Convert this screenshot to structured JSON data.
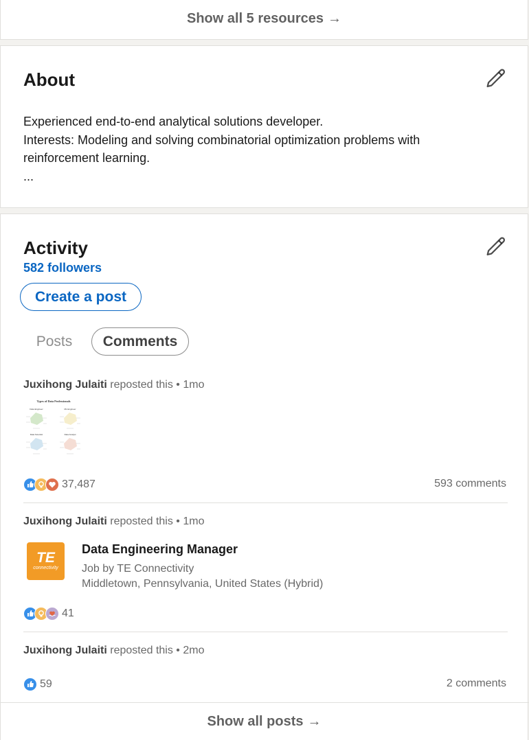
{
  "resources": {
    "show_all_label": "Show all 5 resources",
    "arrow": "→"
  },
  "about": {
    "title": "About",
    "lines": [
      "Experienced end-to-end analytical solutions developer.",
      "Interests: Modeling and solving combinatorial optimization problems with",
      "reinforcement learning.",
      "..."
    ]
  },
  "activity": {
    "title": "Activity",
    "followers": "582 followers",
    "create_post_label": "Create a post",
    "tabs": [
      {
        "label": "Posts",
        "selected": false
      },
      {
        "label": "Comments",
        "selected": true
      }
    ],
    "items": [
      {
        "reposter": "Juxihong Julaiti",
        "action": " reposted this • 1mo",
        "reaction_icons": [
          "like-icon",
          "insightful-icon",
          "love-icon"
        ],
        "reaction_count": "37,487",
        "comments": "593 comments",
        "image_title": "Types of Data Professionals",
        "image_labels": [
          "Data Engineer",
          "ML Engineer",
          "Data Scientist",
          "Data Analyst"
        ]
      },
      {
        "reposter": "Juxihong Julaiti",
        "action": " reposted this • 1mo",
        "job": {
          "logo_text": "TE",
          "logo_subtext": "connectivity",
          "title": "Data Engineering Manager",
          "company_line": "Job by TE Connectivity",
          "location": "Middletown, Pennsylvania, United States (Hybrid)"
        },
        "reaction_icons": [
          "like-icon",
          "insightful-icon",
          "support-icon"
        ],
        "reaction_count": "41"
      },
      {
        "reposter": "Juxihong Julaiti",
        "action": " reposted this • 2mo",
        "reaction_icons": [
          "like-icon"
        ],
        "reaction_count": "59",
        "comments": "2 comments"
      }
    ],
    "show_all_label": "Show all posts",
    "arrow": "→"
  },
  "colors": {
    "link_blue": "#0a66c2",
    "te_orange": "#f29b26",
    "page_bg": "#f3f2ef"
  }
}
